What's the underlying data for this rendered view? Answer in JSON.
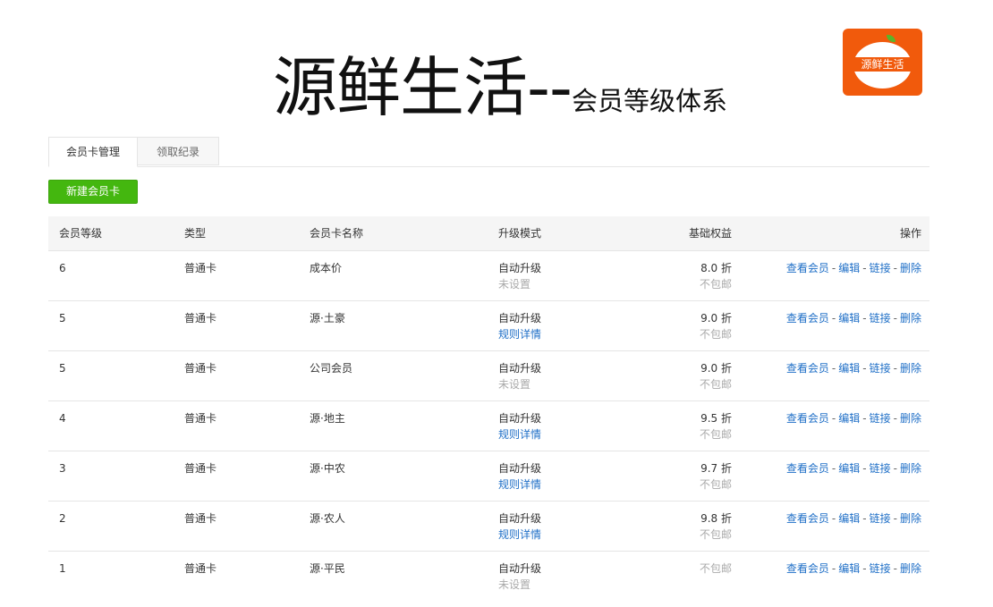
{
  "header": {
    "title_main": "源鲜生活--",
    "title_sub": "会员等级体系",
    "logo_text": "源鲜生活"
  },
  "tabs": [
    {
      "label": "会员卡管理",
      "active": true
    },
    {
      "label": "领取纪录",
      "active": false
    }
  ],
  "new_card_button": "新建会员卡",
  "table": {
    "columns": {
      "level": "会员等级",
      "type": "类型",
      "name": "会员卡名称",
      "mode": "升级模式",
      "benefit": "基础权益",
      "ops": "操作"
    },
    "ops_labels": {
      "view": "查看会员",
      "edit": "编辑",
      "link": "链接",
      "delete": "删除",
      "separator": "-"
    },
    "rows": [
      {
        "level": "6",
        "type": "普通卡",
        "name": "成本价",
        "mode": "自动升级",
        "mode_sub": "未设置",
        "mode_sub_link": false,
        "discount": "8.0 折",
        "shipping": "不包邮"
      },
      {
        "level": "5",
        "type": "普通卡",
        "name": "源·土豪",
        "mode": "自动升级",
        "mode_sub": "规则详情",
        "mode_sub_link": true,
        "discount": "9.0 折",
        "shipping": "不包邮"
      },
      {
        "level": "5",
        "type": "普通卡",
        "name": "公司会员",
        "mode": "自动升级",
        "mode_sub": "未设置",
        "mode_sub_link": false,
        "discount": "9.0 折",
        "shipping": "不包邮"
      },
      {
        "level": "4",
        "type": "普通卡",
        "name": "源·地主",
        "mode": "自动升级",
        "mode_sub": "规则详情",
        "mode_sub_link": true,
        "discount": "9.5 折",
        "shipping": "不包邮"
      },
      {
        "level": "3",
        "type": "普通卡",
        "name": "源·中农",
        "mode": "自动升级",
        "mode_sub": "规则详情",
        "mode_sub_link": true,
        "discount": "9.7 折",
        "shipping": "不包邮"
      },
      {
        "level": "2",
        "type": "普通卡",
        "name": "源·农人",
        "mode": "自动升级",
        "mode_sub": "规则详情",
        "mode_sub_link": true,
        "discount": "9.8 折",
        "shipping": "不包邮"
      },
      {
        "level": "1",
        "type": "普通卡",
        "name": "源·平民",
        "mode": "自动升级",
        "mode_sub": "未设置",
        "mode_sub_link": false,
        "discount": "",
        "shipping": "不包邮"
      }
    ]
  },
  "colors": {
    "accent_green": "#44b70f",
    "link_blue": "#1f6fc7",
    "logo_orange": "#f15a0c"
  }
}
